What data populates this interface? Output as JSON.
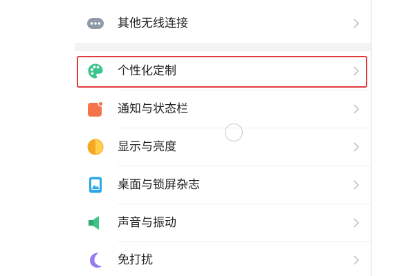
{
  "settings": {
    "items": [
      {
        "label": "其他无线连接",
        "icon": "more-dots-icon",
        "color": "#8e9aa8"
      },
      {
        "label": "个性化定制",
        "icon": "palette-icon",
        "color": "#3cc489"
      },
      {
        "label": "通知与状态栏",
        "icon": "notification-icon",
        "color": "#f5734a"
      },
      {
        "label": "显示与亮度",
        "icon": "brightness-icon",
        "color": "#f5a623"
      },
      {
        "label": "桌面与锁屏杂志",
        "icon": "wallpaper-icon",
        "color": "#2aa7e8"
      },
      {
        "label": "声音与振动",
        "icon": "speaker-icon",
        "color": "#3cc489"
      },
      {
        "label": "免打扰",
        "icon": "moon-icon",
        "color": "#9b7bea"
      }
    ]
  },
  "colors": {
    "highlight": "#e03a3a",
    "divider": "#ececec",
    "chevron": "#c2c2c2"
  }
}
